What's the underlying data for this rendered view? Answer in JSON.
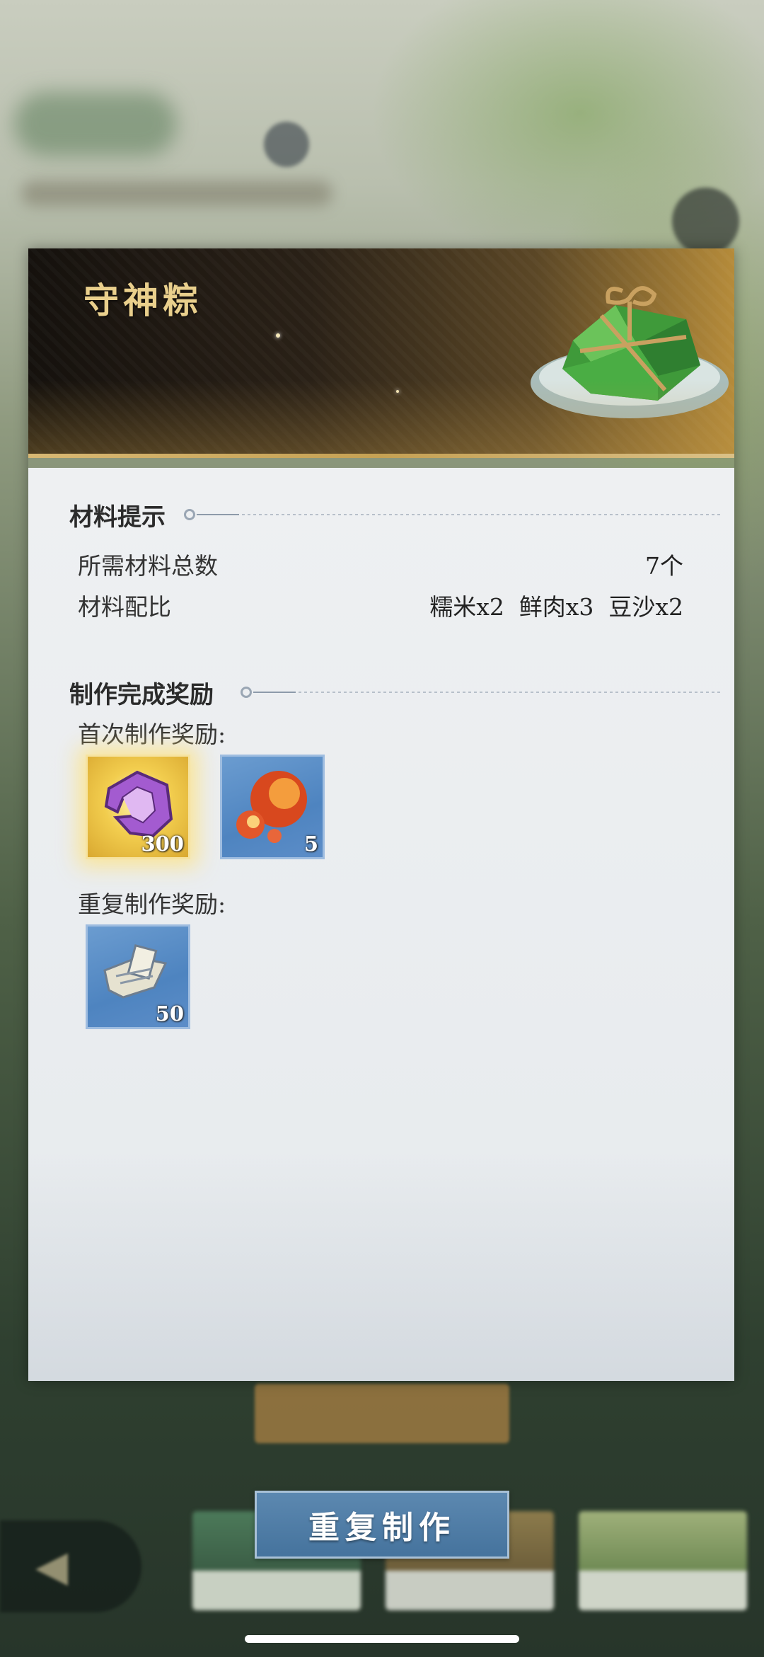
{
  "dialog": {
    "title": "守神粽",
    "item_image": "zongzi-on-plate"
  },
  "materials": {
    "heading": "材料提示",
    "rows": [
      {
        "label": "所需材料总数",
        "value": "7个"
      },
      {
        "label": "材料配比",
        "value": "糯米x2  鲜肉x3  豆沙x2"
      }
    ]
  },
  "rewards": {
    "heading": "制作完成奖励",
    "first_time": {
      "label": "首次制作奖励:",
      "items": [
        {
          "icon": "purple-crest-icon",
          "count": "300",
          "rarity": "gold"
        },
        {
          "icon": "fire-orbs-icon",
          "count": "5",
          "rarity": "blue"
        }
      ]
    },
    "repeat": {
      "label": "重复制作奖励:",
      "items": [
        {
          "icon": "scroll-icon",
          "count": "50",
          "rarity": "blue"
        }
      ]
    }
  },
  "actions": {
    "repeat_label": "重复制作"
  },
  "colors": {
    "title_gold": "#e9cf8c",
    "button_blue": "#4f7da6",
    "panel_bg": "#eceff1"
  }
}
